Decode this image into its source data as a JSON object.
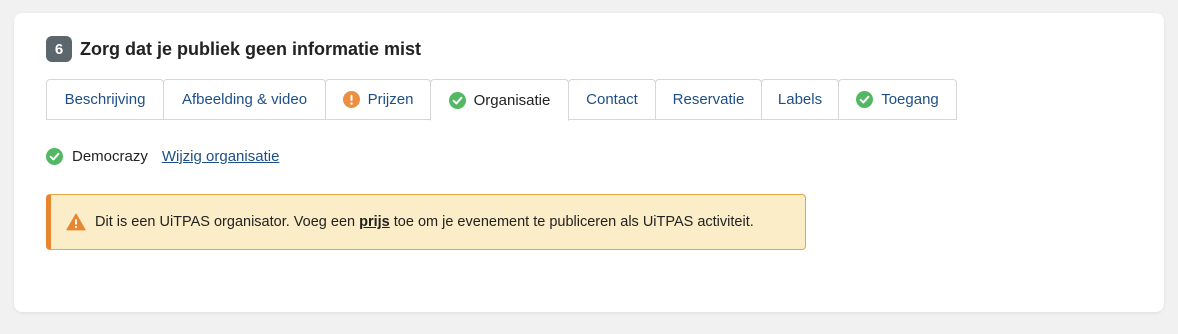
{
  "step": {
    "number": "6",
    "title": "Zorg dat je publiek geen informatie mist"
  },
  "tabs": [
    {
      "label": "Beschrijving",
      "status": "none",
      "active": false
    },
    {
      "label": "Afbeelding & video",
      "status": "none",
      "active": false
    },
    {
      "label": "Prijzen",
      "status": "warning",
      "active": false
    },
    {
      "label": "Organisatie",
      "status": "complete",
      "active": true
    },
    {
      "label": "Contact",
      "status": "none",
      "active": false
    },
    {
      "label": "Reservatie",
      "status": "none",
      "active": false
    },
    {
      "label": "Labels",
      "status": "none",
      "active": false
    },
    {
      "label": "Toegang",
      "status": "complete",
      "active": false
    }
  ],
  "organization": {
    "name": "Democrazy",
    "change_link": "Wijzig organisatie"
  },
  "alert": {
    "text_before": "Dit is een UiTPAS organisator. Voeg een ",
    "link": "prijs",
    "text_after": " toe om je evenement te publiceren als UiTPAS activiteit."
  },
  "colors": {
    "accent": "#1d4f86",
    "success": "#53b863",
    "warning": "#ec8f3f",
    "alert_bg": "#fbedc7",
    "alert_border": "#e7862e",
    "badge_bg": "#5c666d"
  },
  "icons": {
    "complete": "check-circle-icon",
    "warning": "exclamation-circle-icon",
    "alert": "warning-triangle-icon"
  }
}
